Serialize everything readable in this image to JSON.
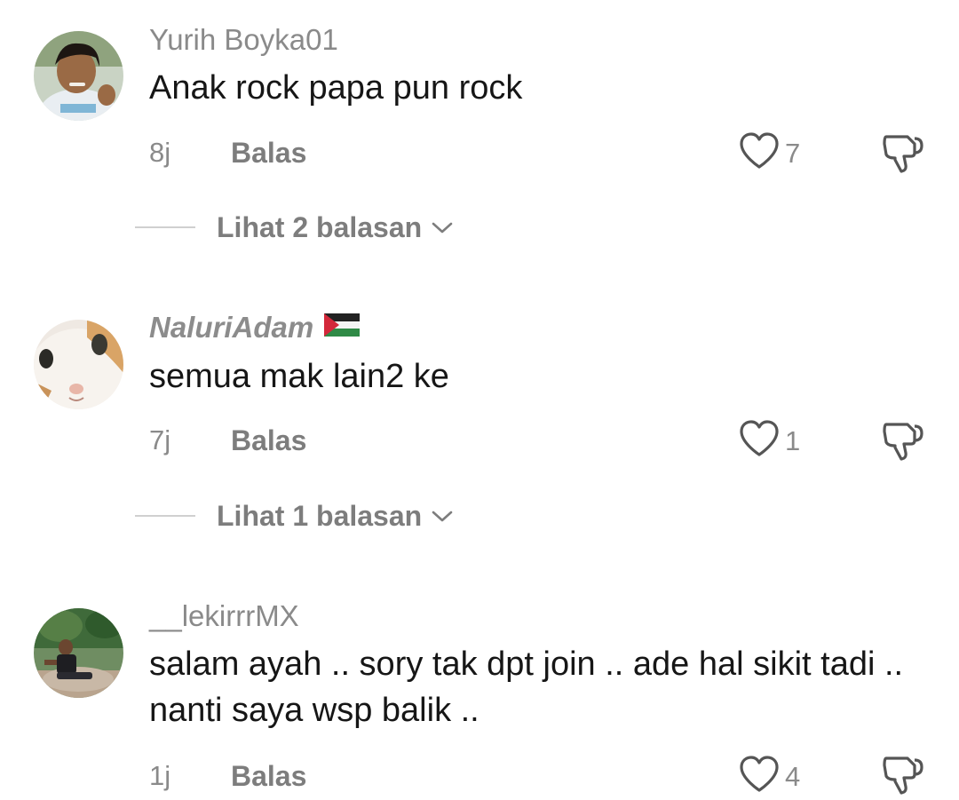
{
  "comments": [
    {
      "username": "Yurih Boyka01",
      "text": "Anak rock papa pun rock",
      "time": "8j",
      "reply_label": "Balas",
      "like_count": "7",
      "view_replies": "Lihat 2 balasan"
    },
    {
      "username": "NaluriAdam",
      "text": "semua mak lain2 ke",
      "time": "7j",
      "reply_label": "Balas",
      "like_count": "1",
      "view_replies": "Lihat 1 balasan"
    },
    {
      "username": "__lekirrrMX",
      "text": "salam ayah .. sory tak dpt join .. ade hal sikit tadi .. nanti saya wsp balik ..",
      "time": "1j",
      "reply_label": "Balas",
      "like_count": "4"
    }
  ],
  "icons": {
    "like": "heart-outline-icon",
    "dislike": "thumbs-down-outline-icon",
    "expand": "chevron-down-icon",
    "flag": "palestine-flag-icon"
  },
  "colors": {
    "text": "#161616",
    "muted": "#8a8a8a",
    "icon": "#555555"
  }
}
